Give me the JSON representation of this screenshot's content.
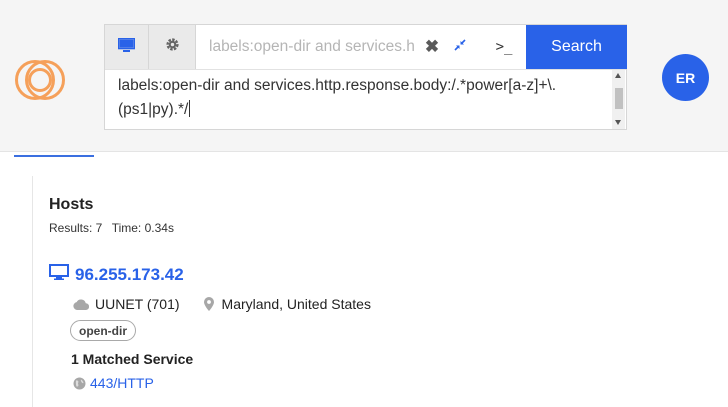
{
  "search": {
    "query_value": "labels:open-dir and services.http.response.body:/.*power[a-z]+\\.(ps1|py).*/",
    "query_display": "labels:open-dir and services.http.response.body:/.*power[a-z]+\\.\n(ps1|py).*/",
    "cli_symbol": ">_",
    "button_label": "Search"
  },
  "user": {
    "initials": "ER"
  },
  "results": {
    "heading": "Hosts",
    "count_text": "Results: 7",
    "time_text": "Time: 0.34s"
  },
  "hosts": [
    {
      "ip": "96.255.173.42",
      "asn": "UUNET (701)",
      "location": "Maryland, United States",
      "label": "open-dir",
      "matched_services": "1 Matched Service",
      "service": "443/HTTP"
    }
  ],
  "colors": {
    "accent": "#2962e8",
    "logo": "#f5a05a",
    "header_bg": "#f5f5f5"
  },
  "icons": {
    "host_toggle": "desktop-icon",
    "settings": "gear-icon",
    "clear": "close-icon",
    "collapse": "collapse-icon",
    "asn": "cloud-icon",
    "location": "map-pin-icon",
    "service": "globe-icon",
    "host": "desktop-icon"
  }
}
